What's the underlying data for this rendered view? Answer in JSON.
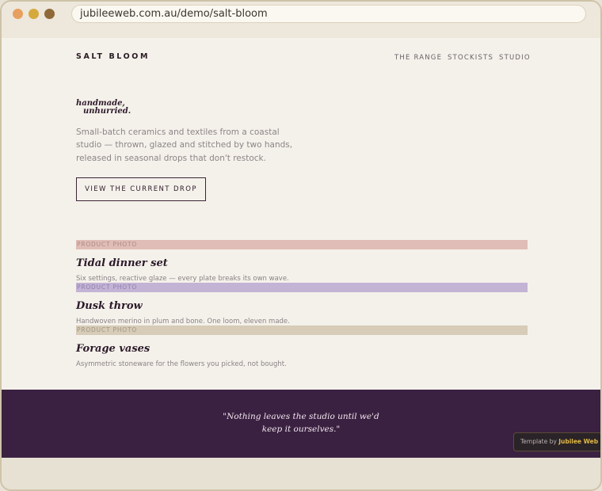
{
  "browser": {
    "url": "jubileeweb.com.au/demo/salt-bloom",
    "window_controls": [
      {
        "name": "close",
        "color": "#e8a05e"
      },
      {
        "name": "minimize",
        "color": "#d6a93c"
      },
      {
        "name": "maximize",
        "color": "#8f6a38"
      }
    ]
  },
  "site": {
    "brand": "SALT BLOOM",
    "nav": [
      "THE RANGE",
      "STOCKISTS",
      "STUDIO"
    ]
  },
  "hero": {
    "title_line1": "handmade,",
    "title_line2": "unhurried.",
    "description": "Small-batch ceramics and textiles from a coastal studio — thrown, glazed and stitched by two hands, released in seasonal drops that don't restock.",
    "cta_label": "VIEW THE CURRENT DROP"
  },
  "products": [
    {
      "photo_label": "PRODUCT PHOTO",
      "name": "Tidal dinner set",
      "description": "Six settings, reactive glaze — every plate breaks its own wave.",
      "photo_color": "#e0bdb6",
      "label_color": "#b08a85"
    },
    {
      "photo_label": "PRODUCT PHOTO",
      "name": "Dusk throw",
      "description": "Handwoven merino in plum and bone. One loom, eleven made.",
      "photo_color": "#c3b3d5",
      "label_color": "#8f7fb0"
    },
    {
      "photo_label": "PRODUCT PHOTO",
      "name": "Forage vases",
      "description": "Asymmetric stoneware for the flowers you picked, not bought.",
      "photo_color": "#d6ccb7",
      "label_color": "#9e9480"
    }
  ],
  "footer": {
    "quote_line1": "\"Nothing leaves the studio until we'd",
    "quote_line2": "keep it ourselves.\"",
    "badge_prefix": "Template by ",
    "badge_name": "Jubilee Web"
  },
  "colors": {
    "page_bg": "#f4f1ea",
    "footer_bg": "#3b2141",
    "accent_gold": "#e0b846"
  }
}
